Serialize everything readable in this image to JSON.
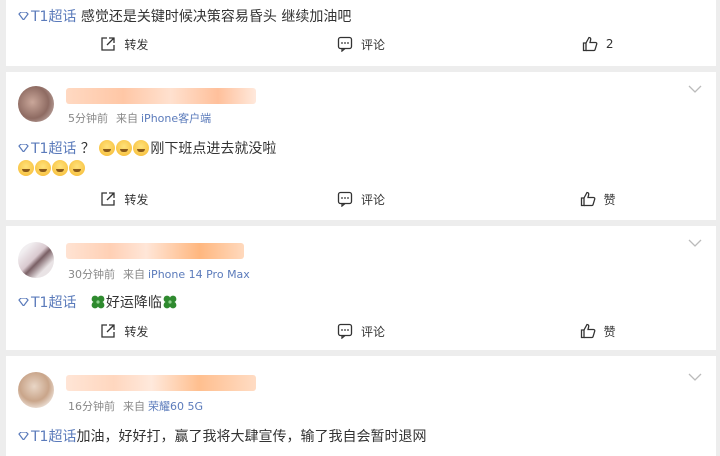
{
  "topic_label": "T1超话",
  "posts": [
    {
      "text": "感觉还是关键时候决策容易昏头 继续加油吧",
      "actions": {
        "repost": "转发",
        "comment": "评论",
        "like": "2"
      }
    },
    {
      "meta": {
        "time": "5分钟前",
        "from": "来自",
        "device": "iPhone客户端"
      },
      "text_a": "？",
      "text_b": "刚下班点进去就没啦",
      "actions": {
        "repost": "转发",
        "comment": "评论",
        "like": "赞"
      }
    },
    {
      "meta": {
        "time": "30分钟前",
        "from": "来自",
        "device": "iPhone 14 Pro Max"
      },
      "text": "好运降临",
      "actions": {
        "repost": "转发",
        "comment": "评论",
        "like": "赞"
      }
    },
    {
      "meta": {
        "time": "16分钟前",
        "from": "来自",
        "device": "荣耀60 5G"
      },
      "text": "加油，好好打，赢了我将大肆宣传，输了我自会暂时退网"
    }
  ],
  "colors": {
    "topic": "#5b7bbb",
    "meta_link": "#5b7bbb",
    "background": "#ededed"
  }
}
